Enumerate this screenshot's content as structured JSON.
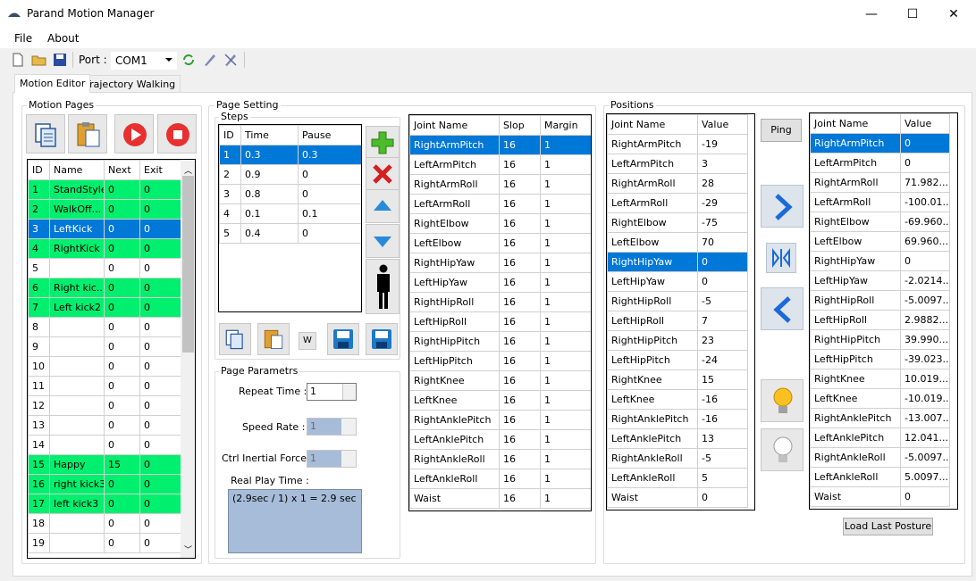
{
  "window": {
    "title": "Parand Motion Manager",
    "minimize": "—",
    "maximize": "☐",
    "close": "✕"
  },
  "menu": {
    "file": "File",
    "about": "About"
  },
  "toolbar": {
    "port_label": "Port :",
    "port_value": "COM1"
  },
  "tabs": [
    {
      "label": "Motion Editor"
    },
    {
      "label": "Trajectory Walking"
    }
  ],
  "motion_pages": {
    "title": "Motion Pages",
    "headers": [
      "ID",
      "Name",
      "Next",
      "Exit"
    ],
    "rows": [
      {
        "id": "1",
        "name": "StandStyle",
        "next": "0",
        "exit": "0",
        "state": "green"
      },
      {
        "id": "2",
        "name": "WalkOff...",
        "next": "0",
        "exit": "0",
        "state": "green"
      },
      {
        "id": "3",
        "name": "LeftKick",
        "next": "0",
        "exit": "0",
        "state": "sel"
      },
      {
        "id": "4",
        "name": "RightKick",
        "next": "0",
        "exit": "0",
        "state": "green"
      },
      {
        "id": "5",
        "name": "",
        "next": "0",
        "exit": "0",
        "state": ""
      },
      {
        "id": "6",
        "name": "Right kic...",
        "next": "0",
        "exit": "0",
        "state": "green"
      },
      {
        "id": "7",
        "name": "Left kick2",
        "next": "0",
        "exit": "0",
        "state": "green"
      },
      {
        "id": "8",
        "name": "",
        "next": "0",
        "exit": "0",
        "state": ""
      },
      {
        "id": "9",
        "name": "",
        "next": "0",
        "exit": "0",
        "state": ""
      },
      {
        "id": "10",
        "name": "",
        "next": "0",
        "exit": "0",
        "state": ""
      },
      {
        "id": "11",
        "name": "",
        "next": "0",
        "exit": "0",
        "state": ""
      },
      {
        "id": "12",
        "name": "",
        "next": "0",
        "exit": "0",
        "state": ""
      },
      {
        "id": "13",
        "name": "",
        "next": "0",
        "exit": "0",
        "state": ""
      },
      {
        "id": "14",
        "name": "",
        "next": "0",
        "exit": "0",
        "state": ""
      },
      {
        "id": "15",
        "name": "Happy",
        "next": "15",
        "exit": "0",
        "state": "green"
      },
      {
        "id": "16",
        "name": "right kick3",
        "next": "0",
        "exit": "0",
        "state": "green"
      },
      {
        "id": "17",
        "name": "left kick3",
        "next": "0",
        "exit": "0",
        "state": "green"
      },
      {
        "id": "18",
        "name": "",
        "next": "0",
        "exit": "0",
        "state": ""
      },
      {
        "id": "19",
        "name": "",
        "next": "0",
        "exit": "0",
        "state": ""
      }
    ]
  },
  "page_setting": {
    "title": "Page Setting",
    "steps_title": "Steps",
    "step_headers": [
      "ID",
      "Time",
      "Pause"
    ],
    "steps": [
      {
        "id": "1",
        "time": "0.3",
        "pause": "0.3",
        "state": "sel"
      },
      {
        "id": "2",
        "time": "0.9",
        "pause": "0",
        "state": ""
      },
      {
        "id": "3",
        "time": "0.8",
        "pause": "0",
        "state": ""
      },
      {
        "id": "4",
        "time": "0.1",
        "pause": "0.1",
        "state": ""
      },
      {
        "id": "5",
        "time": "0.4",
        "pause": "0",
        "state": ""
      }
    ],
    "w_button": "W",
    "params_title": "Page Parametrs",
    "repeat_label": "Repeat Time :",
    "repeat_value": "1",
    "speed_label": "Speed Rate :",
    "speed_value": "1",
    "inertial_label": "Ctrl Inertial Force :",
    "inertial_value": "1",
    "real_play_label": "Real Play Time :",
    "real_play_value": "(2.9sec / 1) x 1 =  2.9 sec"
  },
  "joints": {
    "headers": [
      "Joint Name",
      "Slop",
      "Margin"
    ],
    "rows": [
      {
        "name": "RightArmPitch",
        "slop": "16",
        "margin": "1",
        "state": "sel"
      },
      {
        "name": "LeftArmPitch",
        "slop": "16",
        "margin": "1",
        "state": ""
      },
      {
        "name": "RightArmRoll",
        "slop": "16",
        "margin": "1",
        "state": ""
      },
      {
        "name": "LeftArmRoll",
        "slop": "16",
        "margin": "1",
        "state": ""
      },
      {
        "name": "RightElbow",
        "slop": "16",
        "margin": "1",
        "state": ""
      },
      {
        "name": "LeftElbow",
        "slop": "16",
        "margin": "1",
        "state": ""
      },
      {
        "name": "RightHipYaw",
        "slop": "16",
        "margin": "1",
        "state": ""
      },
      {
        "name": "LeftHipYaw",
        "slop": "16",
        "margin": "1",
        "state": ""
      },
      {
        "name": "RightHipRoll",
        "slop": "16",
        "margin": "1",
        "state": ""
      },
      {
        "name": "LeftHipRoll",
        "slop": "16",
        "margin": "1",
        "state": ""
      },
      {
        "name": "RightHipPitch",
        "slop": "16",
        "margin": "1",
        "state": ""
      },
      {
        "name": "LeftHipPitch",
        "slop": "16",
        "margin": "1",
        "state": ""
      },
      {
        "name": "RightKnee",
        "slop": "16",
        "margin": "1",
        "state": ""
      },
      {
        "name": "LeftKnee",
        "slop": "16",
        "margin": "1",
        "state": ""
      },
      {
        "name": "RightAnklePitch",
        "slop": "16",
        "margin": "1",
        "state": ""
      },
      {
        "name": "LeftAnklePitch",
        "slop": "16",
        "margin": "1",
        "state": ""
      },
      {
        "name": "RightAnkleRoll",
        "slop": "16",
        "margin": "1",
        "state": ""
      },
      {
        "name": "LeftAnkleRoll",
        "slop": "16",
        "margin": "1",
        "state": ""
      },
      {
        "name": "Waist",
        "slop": "16",
        "margin": "1",
        "state": ""
      }
    ]
  },
  "positions": {
    "title": "Positions",
    "headers": [
      "Joint Name",
      "Value"
    ],
    "rows": [
      {
        "name": "RightArmPitch",
        "value": "-19",
        "state": ""
      },
      {
        "name": "LeftArmPitch",
        "value": "3",
        "state": ""
      },
      {
        "name": "RightArmRoll",
        "value": "28",
        "state": ""
      },
      {
        "name": "LeftArmRoll",
        "value": "-29",
        "state": ""
      },
      {
        "name": "RightElbow",
        "value": "-75",
        "state": ""
      },
      {
        "name": "LeftElbow",
        "value": "70",
        "state": ""
      },
      {
        "name": "RightHipYaw",
        "value": "0",
        "state": "sel"
      },
      {
        "name": "LeftHipYaw",
        "value": "0",
        "state": ""
      },
      {
        "name": "RightHipRoll",
        "value": "-5",
        "state": ""
      },
      {
        "name": "LeftHipRoll",
        "value": "7",
        "state": ""
      },
      {
        "name": "RightHipPitch",
        "value": "23",
        "state": ""
      },
      {
        "name": "LeftHipPitch",
        "value": "-24",
        "state": ""
      },
      {
        "name": "RightKnee",
        "value": "15",
        "state": ""
      },
      {
        "name": "LeftKnee",
        "value": "-16",
        "state": ""
      },
      {
        "name": "RightAnklePitch",
        "value": "-16",
        "state": ""
      },
      {
        "name": "LeftAnklePitch",
        "value": "13",
        "state": ""
      },
      {
        "name": "RightAnkleRoll",
        "value": "-5",
        "state": ""
      },
      {
        "name": "LeftAnkleRoll",
        "value": "5",
        "state": ""
      },
      {
        "name": "Waist",
        "value": "0",
        "state": ""
      }
    ],
    "ping_button": "Ping"
  },
  "robot_positions": {
    "headers": [
      "Joint Name",
      "Value"
    ],
    "rows": [
      {
        "name": "RightArmPitch",
        "value": "0",
        "state": "sel"
      },
      {
        "name": "LeftArmPitch",
        "value": "0",
        "state": ""
      },
      {
        "name": "RightArmRoll",
        "value": "71.982...",
        "state": ""
      },
      {
        "name": "LeftArmRoll",
        "value": "-100.01...",
        "state": ""
      },
      {
        "name": "RightElbow",
        "value": "-69.960...",
        "state": ""
      },
      {
        "name": "LeftElbow",
        "value": "69.960...",
        "state": ""
      },
      {
        "name": "RightHipYaw",
        "value": "0",
        "state": ""
      },
      {
        "name": "LeftHipYaw",
        "value": "-2.0214...",
        "state": ""
      },
      {
        "name": "RightHipRoll",
        "value": "-5.0097...",
        "state": ""
      },
      {
        "name": "LeftHipRoll",
        "value": "2.9882...",
        "state": ""
      },
      {
        "name": "RightHipPitch",
        "value": "39.990...",
        "state": ""
      },
      {
        "name": "LeftHipPitch",
        "value": "-39.023...",
        "state": ""
      },
      {
        "name": "RightKnee",
        "value": "10.019...",
        "state": ""
      },
      {
        "name": "LeftKnee",
        "value": "-10.019...",
        "state": ""
      },
      {
        "name": "RightAnklePitch",
        "value": "-13.007...",
        "state": ""
      },
      {
        "name": "LeftAnklePitch",
        "value": "12.041...",
        "state": ""
      },
      {
        "name": "RightAnkleRoll",
        "value": "-5.0097...",
        "state": ""
      },
      {
        "name": "LeftAnkleRoll",
        "value": "5.0097...",
        "state": ""
      },
      {
        "name": "Waist",
        "value": "0",
        "state": ""
      }
    ],
    "load_button": "Load Last Posture"
  },
  "colors": {
    "selected": "#0078d7",
    "active_page": "#00ef6e"
  }
}
